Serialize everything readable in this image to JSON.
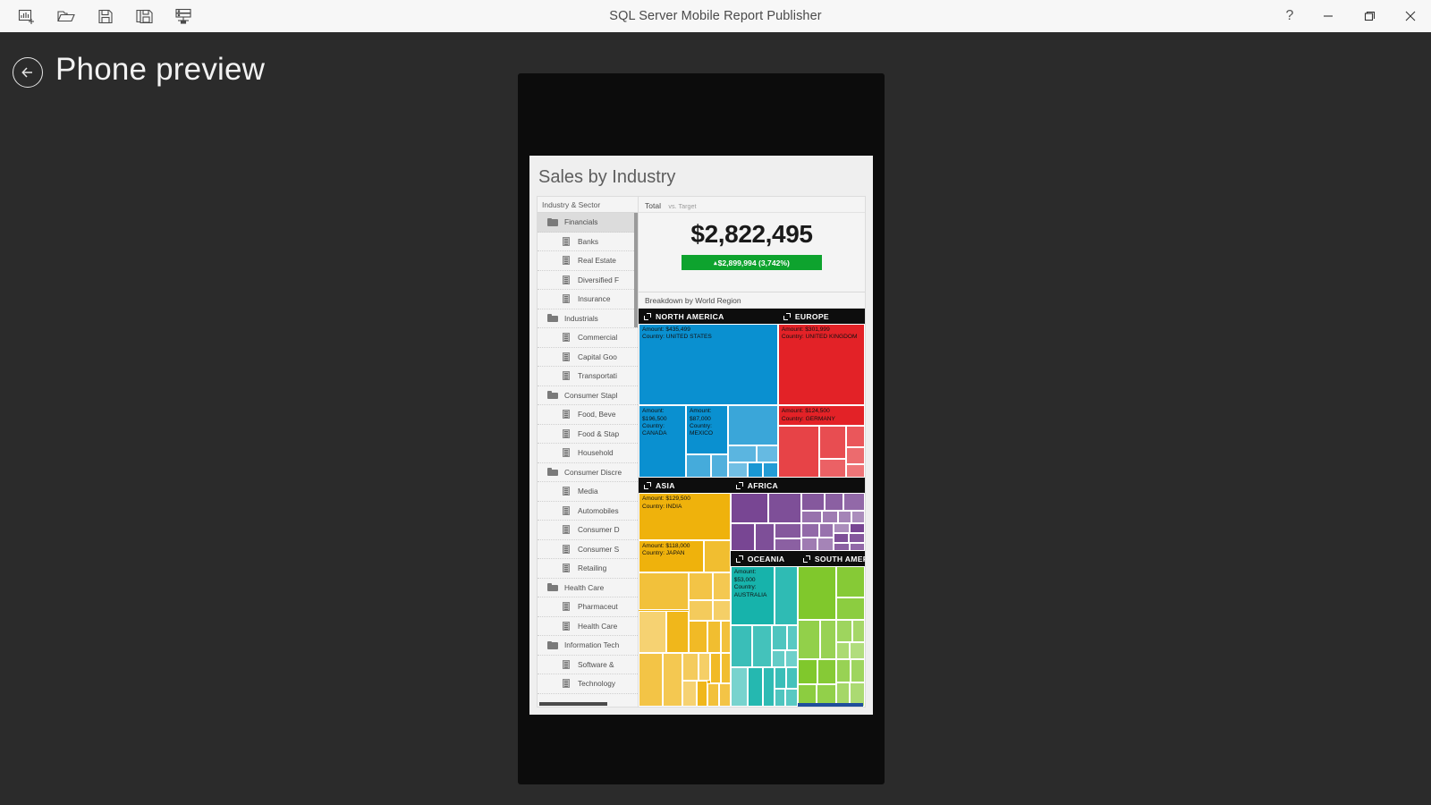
{
  "window": {
    "title": "SQL Server Mobile Report Publisher",
    "toolbar": [
      {
        "name": "new-report-icon",
        "label": "New report"
      },
      {
        "name": "open-icon",
        "label": "Open"
      },
      {
        "name": "save-icon",
        "label": "Save"
      },
      {
        "name": "save-as-icon",
        "label": "Save as"
      },
      {
        "name": "save-to-server-icon",
        "label": "Save to server"
      }
    ],
    "controls": {
      "help": "?",
      "minimize": "—",
      "restore": "❐",
      "close": "✕"
    }
  },
  "page": {
    "back_label": "Back",
    "title": "Phone preview"
  },
  "report": {
    "title": "Sales by Industry",
    "navigator": {
      "header": "Industry & Sector",
      "items": [
        {
          "label": "Financials",
          "type": "folder",
          "level": 0,
          "selected": true
        },
        {
          "label": "Banks",
          "type": "doc",
          "level": 1,
          "selected": false
        },
        {
          "label": "Real Estate",
          "type": "doc",
          "level": 1,
          "selected": false
        },
        {
          "label": "Diversified F",
          "type": "doc",
          "level": 1,
          "selected": false
        },
        {
          "label": "Insurance",
          "type": "doc",
          "level": 1,
          "selected": false
        },
        {
          "label": "Industrials",
          "type": "folder",
          "level": 0,
          "selected": false
        },
        {
          "label": "Commercial",
          "type": "doc",
          "level": 1,
          "selected": false
        },
        {
          "label": "Capital Goo",
          "type": "doc",
          "level": 1,
          "selected": false
        },
        {
          "label": "Transportati",
          "type": "doc",
          "level": 1,
          "selected": false
        },
        {
          "label": "Consumer Stapl",
          "type": "folder",
          "level": 0,
          "selected": false
        },
        {
          "label": "Food, Beve",
          "type": "doc",
          "level": 1,
          "selected": false
        },
        {
          "label": "Food & Stap",
          "type": "doc",
          "level": 1,
          "selected": false
        },
        {
          "label": "Household",
          "type": "doc",
          "level": 1,
          "selected": false
        },
        {
          "label": "Consumer Discre",
          "type": "folder",
          "level": 0,
          "selected": false
        },
        {
          "label": "Media",
          "type": "doc",
          "level": 1,
          "selected": false
        },
        {
          "label": "Automobiles",
          "type": "doc",
          "level": 1,
          "selected": false
        },
        {
          "label": "Consumer D",
          "type": "doc",
          "level": 1,
          "selected": false
        },
        {
          "label": "Consumer S",
          "type": "doc",
          "level": 1,
          "selected": false
        },
        {
          "label": "Retailing",
          "type": "doc",
          "level": 1,
          "selected": false
        },
        {
          "label": "Health Care",
          "type": "folder",
          "level": 0,
          "selected": false
        },
        {
          "label": "Pharmaceut",
          "type": "doc",
          "level": 1,
          "selected": false
        },
        {
          "label": "Health Care",
          "type": "doc",
          "level": 1,
          "selected": false
        },
        {
          "label": "Information Tech",
          "type": "folder",
          "level": 0,
          "selected": false
        },
        {
          "label": "Software & ",
          "type": "doc",
          "level": 1,
          "selected": false
        },
        {
          "label": "Technology",
          "type": "doc",
          "level": 1,
          "selected": false
        }
      ]
    },
    "gauge": {
      "title": "Total",
      "subtitle": "vs. Target",
      "value": "$2,822,495",
      "delta_arrow": "▴",
      "delta": "$2,899,994 (3,742%)",
      "delta_color": "#0ea32e"
    },
    "treemap_title": "Breakdown by World Region"
  },
  "chart_data": {
    "type": "treemap",
    "title": "Breakdown by World Region",
    "measure": "Amount",
    "category": "Country",
    "regions": [
      {
        "name": "NORTH AMERICA",
        "color": "#0a90d0",
        "labeled_cells": [
          {
            "amount": "$435,499",
            "country": "UNITED STATES",
            "amount_value": 435499
          },
          {
            "amount": "$196,500",
            "country": "CANADA",
            "amount_value": 196500
          },
          {
            "amount": "$87,000",
            "country": "MEXICO",
            "amount_value": 87000
          }
        ]
      },
      {
        "name": "EUROPE",
        "color": "#e32227",
        "labeled_cells": [
          {
            "amount": "$301,999",
            "country": "UNITED KINGDOM",
            "amount_value": 301999
          },
          {
            "amount": "$124,500",
            "country": "GERMANY",
            "amount_value": 124500
          }
        ]
      },
      {
        "name": "ASIA",
        "color": "#efb20c",
        "labeled_cells": [
          {
            "amount": "$129,500",
            "country": "INDIA",
            "amount_value": 129500
          },
          {
            "amount": "$118,000",
            "country": "JAPAN",
            "amount_value": 118000
          }
        ]
      },
      {
        "name": "AFRICA",
        "color": "#6f3a8c",
        "labeled_cells": []
      },
      {
        "name": "OCEANIA",
        "color": "#17b3ab",
        "labeled_cells": [
          {
            "amount": "$53,000",
            "country": "AUSTRALIA",
            "amount_value": 53000
          }
        ]
      },
      {
        "name": "SOUTH AMERICA",
        "color": "#78c41e",
        "labeled_cells": []
      }
    ]
  }
}
